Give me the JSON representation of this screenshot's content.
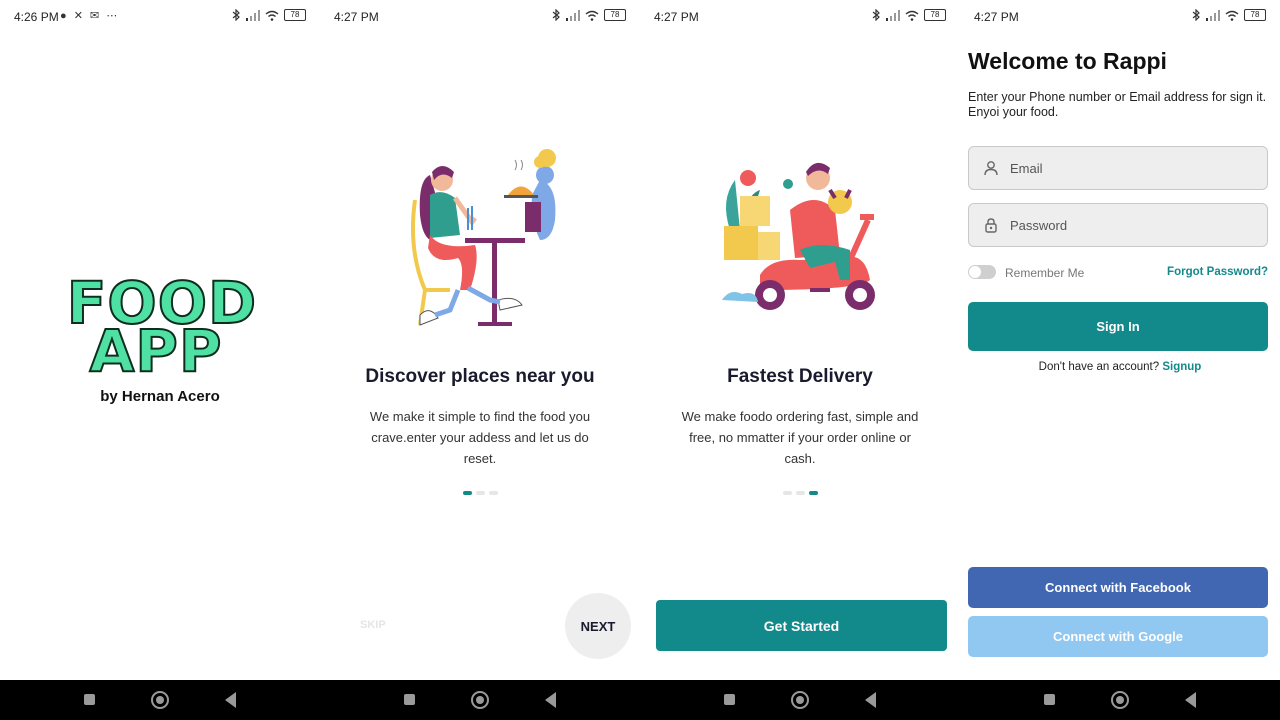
{
  "screen1": {
    "status_time": "4:26 PM",
    "status_notifications": "● ✕ ✉  ⋯",
    "battery": "78",
    "logo_line1": "FOOD",
    "logo_line2": "APP",
    "byline": "by Hernan Acero"
  },
  "screen2": {
    "status_time": "4:27 PM",
    "battery": "78",
    "title": "Discover places near you",
    "description": "We make it simple to find the food you crave.enter your addess and let us do reset.",
    "skip_label": "SKIP",
    "next_label": "NEXT",
    "active_dot": 0
  },
  "screen3": {
    "status_time": "4:27 PM",
    "battery": "78",
    "title": "Fastest Delivery",
    "description": "We make foodo ordering fast, simple and free, no mmatter if your order online or cash.",
    "get_started_label": "Get Started",
    "active_dot": 2
  },
  "screen4": {
    "status_time": "4:27 PM",
    "battery": "78",
    "title": "Welcome to Rappi",
    "subtitle": "Enter your Phone number or Email address for sign it. Enyoi your food.",
    "email_placeholder": "Email",
    "password_placeholder": "Password",
    "remember_label": "Remember Me",
    "forgot_label": "Forgot Password?",
    "sign_in_label": "Sign In",
    "account_prompt": "Don't have an account?",
    "signup_label": "Signup",
    "facebook_label": "Connect with Facebook",
    "google_label": "Connect with Google"
  },
  "colors": {
    "primary": "#128a8c",
    "facebook": "#4267b2",
    "google": "#90c8f2",
    "logo_green": "#4fe0a3",
    "nav_bar": "#000000"
  },
  "icons": {
    "status": [
      "bluetooth-icon",
      "signal-icon",
      "wifi-icon",
      "battery-icon"
    ],
    "navigation": [
      "recents-square-icon",
      "home-circle-icon",
      "back-triangle-icon"
    ],
    "fields": [
      "person-icon",
      "lock-icon"
    ]
  }
}
